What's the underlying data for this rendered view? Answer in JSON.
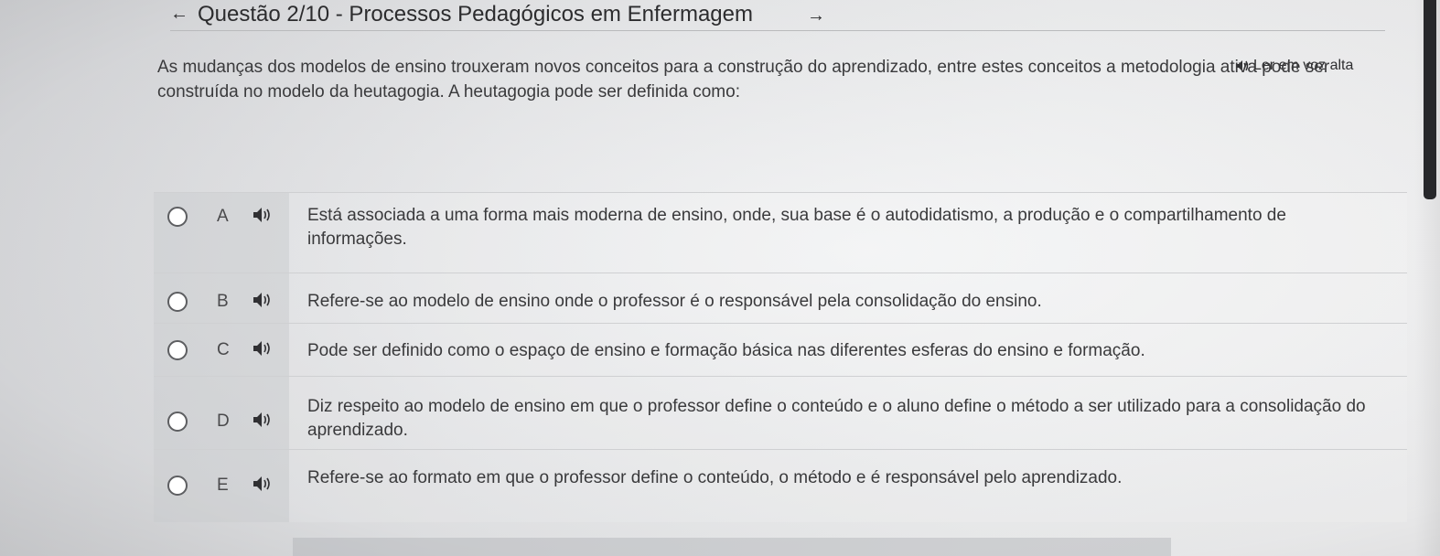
{
  "header": {
    "title": "Questão 2/10 - Processos Pedagógicos em Enfermagem",
    "back_icon": "arrow-left-icon",
    "next_icon": "arrow-right-icon"
  },
  "read_aloud": {
    "label": "Ler em voz alta",
    "icon": "speaker-icon"
  },
  "question": {
    "text": "As mudanças dos modelos de ensino trouxeram novos conceitos para a construção do aprendizado, entre estes conceitos a metodologia ativa pode ser construída no modelo da heutagogia. A heutagogia pode ser definida como:"
  },
  "options": [
    {
      "letter": "A",
      "text": "Está associada a uma forma mais moderna de ensino, onde, sua base é o autodidatismo, a produção e o compartilhamento de informações."
    },
    {
      "letter": "B",
      "text": "Refere-se ao modelo de ensino onde o professor é o responsável pela consolidação do ensino."
    },
    {
      "letter": "C",
      "text": "Pode ser definido como o espaço de ensino e formação básica nas diferentes esferas do ensino e formação."
    },
    {
      "letter": "D",
      "text": "Diz respeito ao modelo de ensino em que o professor define o conteúdo e o aluno define o método a ser utilizado para a consolidação do aprendizado."
    },
    {
      "letter": "E",
      "text": "Refere-se ao formato em que o professor define o conteúdo, o método e é responsável pelo aprendizado."
    }
  ]
}
